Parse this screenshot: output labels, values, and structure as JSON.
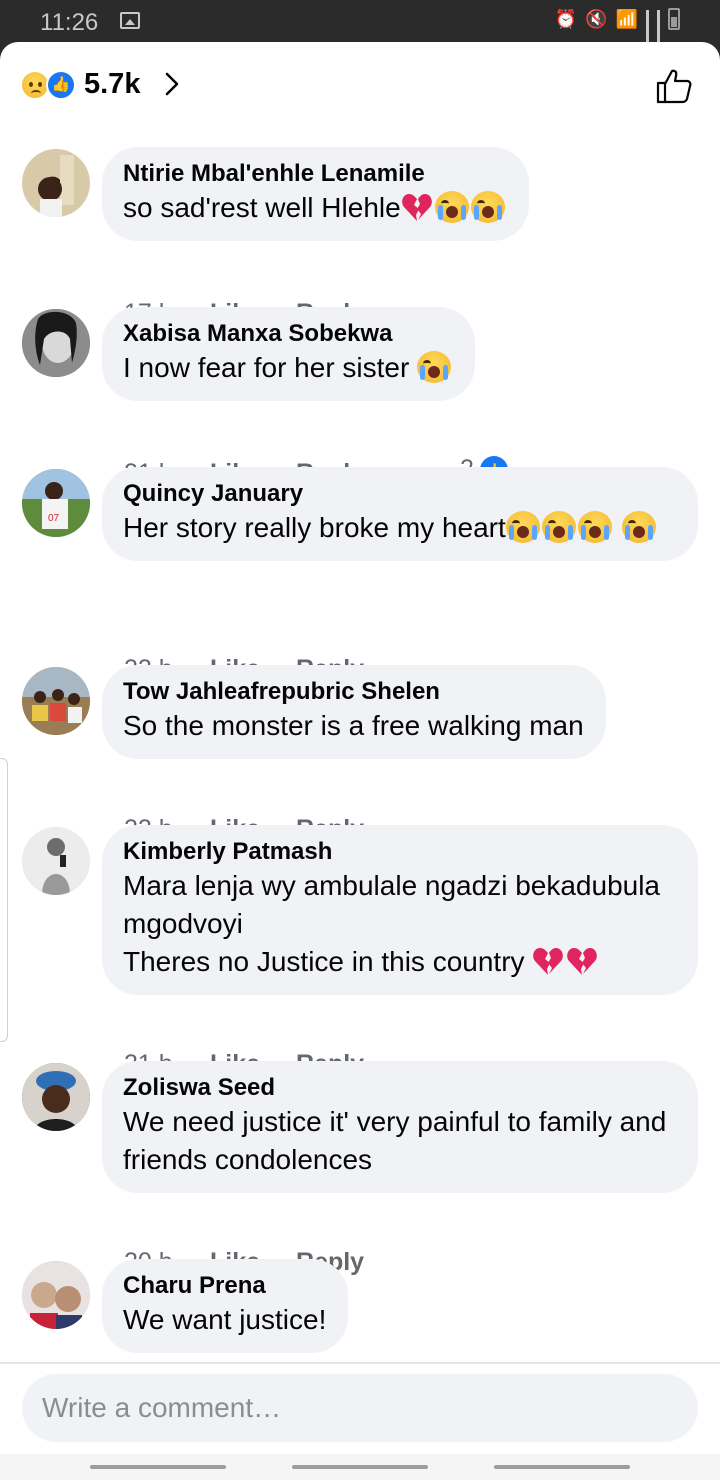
{
  "status_bar": {
    "time": "11:26"
  },
  "reactions": {
    "count": "5.7k",
    "icons": [
      "sad-reaction-icon",
      "like-reaction-icon"
    ]
  },
  "comments": [
    {
      "author": "Ntirie Mbal'enhle Lenamile",
      "text": "so sad'rest well Hlehle",
      "emojis": [
        "broken-heart",
        "crying-face",
        "crying-face"
      ],
      "time": "17 h",
      "like": "Like",
      "reply": "Reply"
    },
    {
      "author": "Xabisa Manxa Sobekwa",
      "text": "I now fear for her sister ",
      "emojis": [
        "crying-face"
      ],
      "time": "21 h",
      "like": "Like",
      "reply": "Reply",
      "reaction_count": "2"
    },
    {
      "author": "Quincy January",
      "text": "Her story really broke my heart",
      "emojis": [
        "crying-face",
        "crying-face",
        "crying-face",
        "crying-face"
      ],
      "time": "22 h",
      "like": "Like",
      "reply": "Reply"
    },
    {
      "author": "Tow Jahleafrepubric Shelen",
      "text": "So the monster is a free walking man",
      "time": "22 h",
      "like": "Like",
      "reply": "Reply"
    },
    {
      "author": "Kimberly Patmash",
      "text": "Mara lenja wy ambulale ngadzi bekadubula mgodvoyi\nTheres no Justice in this country ",
      "emojis": [
        "broken-heart",
        "broken-heart"
      ],
      "time": "21 h",
      "like": "Like",
      "reply": "Reply"
    },
    {
      "author": "Zoliswa Seed",
      "text": "We need justice it' very painful to family and friends condolences",
      "time": "20 h",
      "like": "Like",
      "reply": "Reply"
    },
    {
      "author": "Charu Prena",
      "text": "We want justice!"
    }
  ],
  "composer": {
    "placeholder": "Write a comment…"
  },
  "colors": {
    "bubble": "#f0f2f5",
    "meta_text": "#65676b",
    "like_blue": "#1877f2"
  }
}
